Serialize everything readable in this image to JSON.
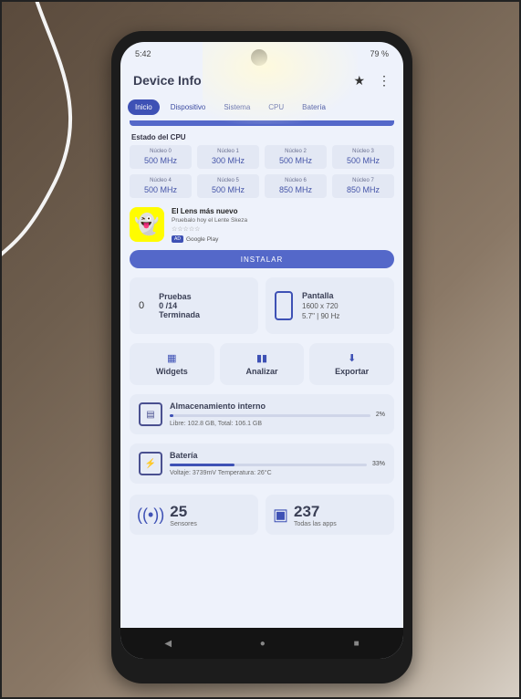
{
  "status_bar": {
    "time": "5:42",
    "right": "79 %"
  },
  "app": {
    "title": "Device Info"
  },
  "tabs": [
    "Inicio",
    "Dispositivo",
    "Sistema",
    "CPU",
    "Batería"
  ],
  "cpu": {
    "title": "Estado del CPU",
    "cores": [
      {
        "label": "Núcleo 0",
        "value": "500 MHz"
      },
      {
        "label": "Núcleo 1",
        "value": "300 MHz"
      },
      {
        "label": "Núcleo 2",
        "value": "500 MHz"
      },
      {
        "label": "Núcleo 3",
        "value": "500 MHz"
      },
      {
        "label": "Núcleo 4",
        "value": "500 MHz"
      },
      {
        "label": "Núcleo 5",
        "value": "500 MHz"
      },
      {
        "label": "Núcleo 6",
        "value": "850 MHz"
      },
      {
        "label": "Núcleo 7",
        "value": "850 MHz"
      }
    ]
  },
  "ad": {
    "title": "El Lens más nuevo",
    "subtitle": "Pruebalo hoy el Lente Skeza",
    "store": "Google Play",
    "store_badge": "AD",
    "install": "INSTALAR"
  },
  "tests": {
    "count": "0",
    "title": "Pruebas",
    "progress": "0 /14",
    "status": "Terminada"
  },
  "display": {
    "title": "Pantalla",
    "resolution": "1600 x 720",
    "detail": "5.7\" | 90 Hz"
  },
  "actions": [
    {
      "icon": "widgets-icon",
      "label": "Widgets"
    },
    {
      "icon": "chart-icon",
      "label": "Analizar"
    },
    {
      "icon": "download-icon",
      "label": "Exportar"
    }
  ],
  "storage": {
    "title": "Almacenamiento interno",
    "percent": "2%",
    "detail": "Libre: 102.8 GB,  Total: 106.1 GB",
    "fill": 0.02
  },
  "battery": {
    "title": "Batería",
    "percent": "33%",
    "detail": "Voltaje: 3739mV  Temperatura: 26°C",
    "fill": 0.33
  },
  "sensors": {
    "count": "25",
    "label": "Sensores"
  },
  "apps": {
    "count": "237",
    "label": "Todas las apps"
  }
}
